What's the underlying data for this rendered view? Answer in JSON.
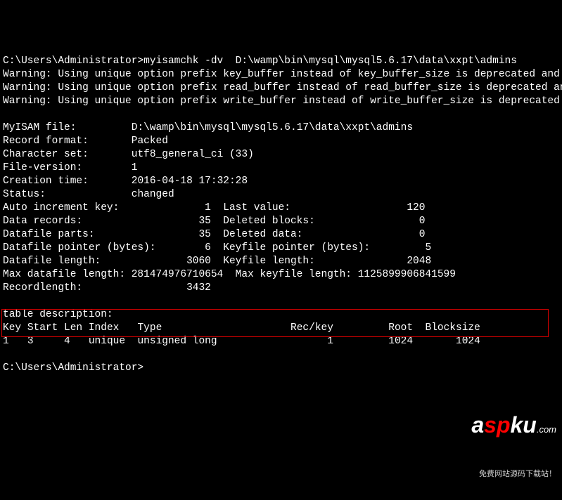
{
  "prompt1": "C:\\Users\\Administrator>",
  "command": "myisamchk -dv  D:\\wamp\\bin\\mysql\\mysql5.6.17\\data\\xxpt\\admins",
  "warnings": {
    "w1": "Warning: Using unique option prefix key_buffer instead of key_buffer_size is deprecated and will be removed in a future release. Please use the full name instead.",
    "w2": "Warning: Using unique option prefix read_buffer instead of read_buffer_size is deprecated and will be removed in a future release. Please use the full name instead.",
    "w3": "Warning: Using unique option prefix write_buffer instead of write_buffer_size is deprecated and will be removed in a future release. Please use the full name instead."
  },
  "file_info": {
    "myisam_file_label": "MyISAM file:",
    "myisam_file_value": "D:\\wamp\\bin\\mysql\\mysql5.6.17\\data\\xxpt\\admins",
    "record_format_label": "Record format:",
    "record_format_value": "Packed",
    "charset_label": "Character set:",
    "charset_value": "utf8_general_ci (33)",
    "file_version_label": "File-version:",
    "file_version_value": "1",
    "creation_time_label": "Creation time:",
    "creation_time_value": "2016-04-18 17:32:28",
    "status_label": "Status:",
    "status_value": "changed"
  },
  "stats": {
    "auto_inc_label": "Auto increment key:",
    "auto_inc_value": "1",
    "last_value_label": "Last value:",
    "last_value_value": "120",
    "data_records_label": "Data records:",
    "data_records_value": "35",
    "deleted_blocks_label": "Deleted blocks:",
    "deleted_blocks_value": "0",
    "datafile_parts_label": "Datafile parts:",
    "datafile_parts_value": "35",
    "deleted_data_label": "Deleted data:",
    "deleted_data_value": "0",
    "datafile_pointer_label": "Datafile pointer (bytes):",
    "datafile_pointer_value": "6",
    "keyfile_pointer_label": "Keyfile pointer (bytes):",
    "keyfile_pointer_value": "5",
    "datafile_length_label": "Datafile length:",
    "datafile_length_value": "3060",
    "keyfile_length_label": "Keyfile length:",
    "keyfile_length_value": "2048",
    "max_datafile_label": "Max datafile length:",
    "max_datafile_value": "281474976710654",
    "max_keyfile_label": "Max keyfile length:",
    "max_keyfile_value": "1125899906841599",
    "recordlength_label": "Recordlength:",
    "recordlength_value": "3432"
  },
  "table_desc": {
    "heading": "table description:",
    "header_key": "Key",
    "header_start": "Start",
    "header_len": "Len",
    "header_index": "Index",
    "header_type": "Type",
    "header_reckey": "Rec/key",
    "header_root": "Root",
    "header_blocksize": "Blocksize",
    "row1_key": "1",
    "row1_start": "3",
    "row1_len": "4",
    "row1_index": "unique",
    "row1_type": "unsigned long",
    "row1_reckey": "1",
    "row1_root": "1024",
    "row1_blocksize": "1024"
  },
  "prompt2": "C:\\Users\\Administrator>",
  "watermark": {
    "a": "a",
    "sp": "sp",
    "ku": "ku",
    "com": ".com",
    "subtitle": "免费网站源码下载站！"
  }
}
